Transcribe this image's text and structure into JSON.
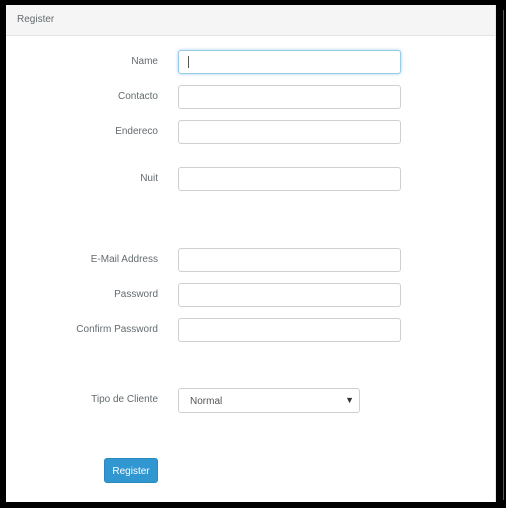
{
  "panel": {
    "title": "Register"
  },
  "form": {
    "fields": [
      {
        "label": "Name",
        "value": "",
        "placeholder": ""
      },
      {
        "label": "Contacto",
        "value": "",
        "placeholder": ""
      },
      {
        "label": "Endereco",
        "value": "",
        "placeholder": ""
      },
      {
        "label": "Nuit",
        "value": "",
        "placeholder": ""
      },
      {
        "label": "E-Mail Address",
        "value": "",
        "placeholder": ""
      },
      {
        "label": "Password",
        "value": "",
        "placeholder": ""
      },
      {
        "label": "Confirm Password",
        "value": "",
        "placeholder": ""
      }
    ],
    "tipo_cliente": {
      "label": "Tipo de Cliente",
      "selected": "Normal",
      "arrow_icon": "▼"
    },
    "submit_label": "Register"
  },
  "colors": {
    "primary": "#3097d1",
    "focus": "#98cbe8"
  }
}
